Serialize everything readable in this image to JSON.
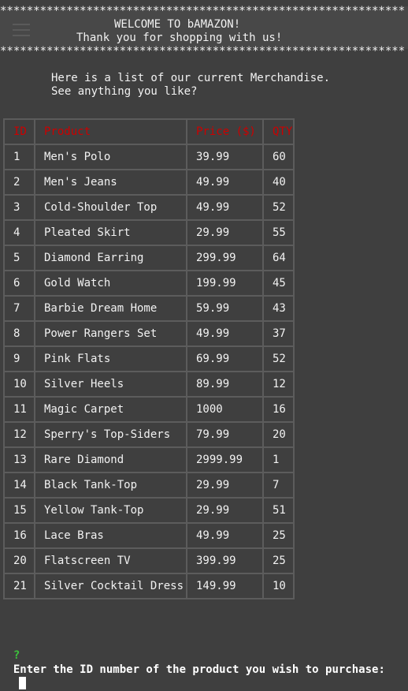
{
  "header": {
    "stars_top": "*************************************************************",
    "welcome": "WELCOME TO bAMAZON!",
    "thanks": "Thank you for shopping with us!",
    "stars_bottom": "*************************************************************"
  },
  "intro": {
    "line1": "Here is a list of our current Merchandise.",
    "line2": "See anything you like?"
  },
  "table": {
    "headers": [
      "ID",
      "Product",
      "Price ($)",
      "QTY"
    ],
    "rows": [
      {
        "id": "1",
        "product": "Men's Polo",
        "price": "39.99",
        "qty": "60"
      },
      {
        "id": "2",
        "product": "Men's Jeans",
        "price": "49.99",
        "qty": "40"
      },
      {
        "id": "3",
        "product": "Cold-Shoulder Top",
        "price": "49.99",
        "qty": "52"
      },
      {
        "id": "4",
        "product": "Pleated Skirt",
        "price": "29.99",
        "qty": "55"
      },
      {
        "id": "5",
        "product": "Diamond Earring",
        "price": "299.99",
        "qty": "64"
      },
      {
        "id": "6",
        "product": "Gold Watch",
        "price": "199.99",
        "qty": "45"
      },
      {
        "id": "7",
        "product": "Barbie Dream Home",
        "price": "59.99",
        "qty": "43"
      },
      {
        "id": "8",
        "product": "Power Rangers Set",
        "price": "49.99",
        "qty": "37"
      },
      {
        "id": "9",
        "product": "Pink Flats",
        "price": "69.99",
        "qty": "52"
      },
      {
        "id": "10",
        "product": "Silver Heels",
        "price": "89.99",
        "qty": "12"
      },
      {
        "id": "11",
        "product": "Magic Carpet",
        "price": "1000",
        "qty": "16"
      },
      {
        "id": "12",
        "product": "Sperry's Top-Siders",
        "price": "79.99",
        "qty": "20"
      },
      {
        "id": "13",
        "product": "Rare Diamond",
        "price": "2999.99",
        "qty": "1"
      },
      {
        "id": "14",
        "product": "Black Tank-Top",
        "price": "29.99",
        "qty": "7"
      },
      {
        "id": "15",
        "product": "Yellow Tank-Top",
        "price": "29.99",
        "qty": "51"
      },
      {
        "id": "16",
        "product": "Lace Bras",
        "price": "49.99",
        "qty": "25"
      },
      {
        "id": "20",
        "product": "Flatscreen TV",
        "price": "399.99",
        "qty": "25"
      },
      {
        "id": "21",
        "product": "Silver Cocktail Dress",
        "price": "149.99",
        "qty": "10"
      }
    ]
  },
  "prompt": {
    "mark": "?",
    "question": "Enter the ID number of the product you wish to purchase:",
    "input_value": ""
  },
  "colors": {
    "background": "#3f3f3f",
    "header_red": "#cc0000",
    "prompt_green": "#3cc23c",
    "border": "#5c5c5c"
  }
}
